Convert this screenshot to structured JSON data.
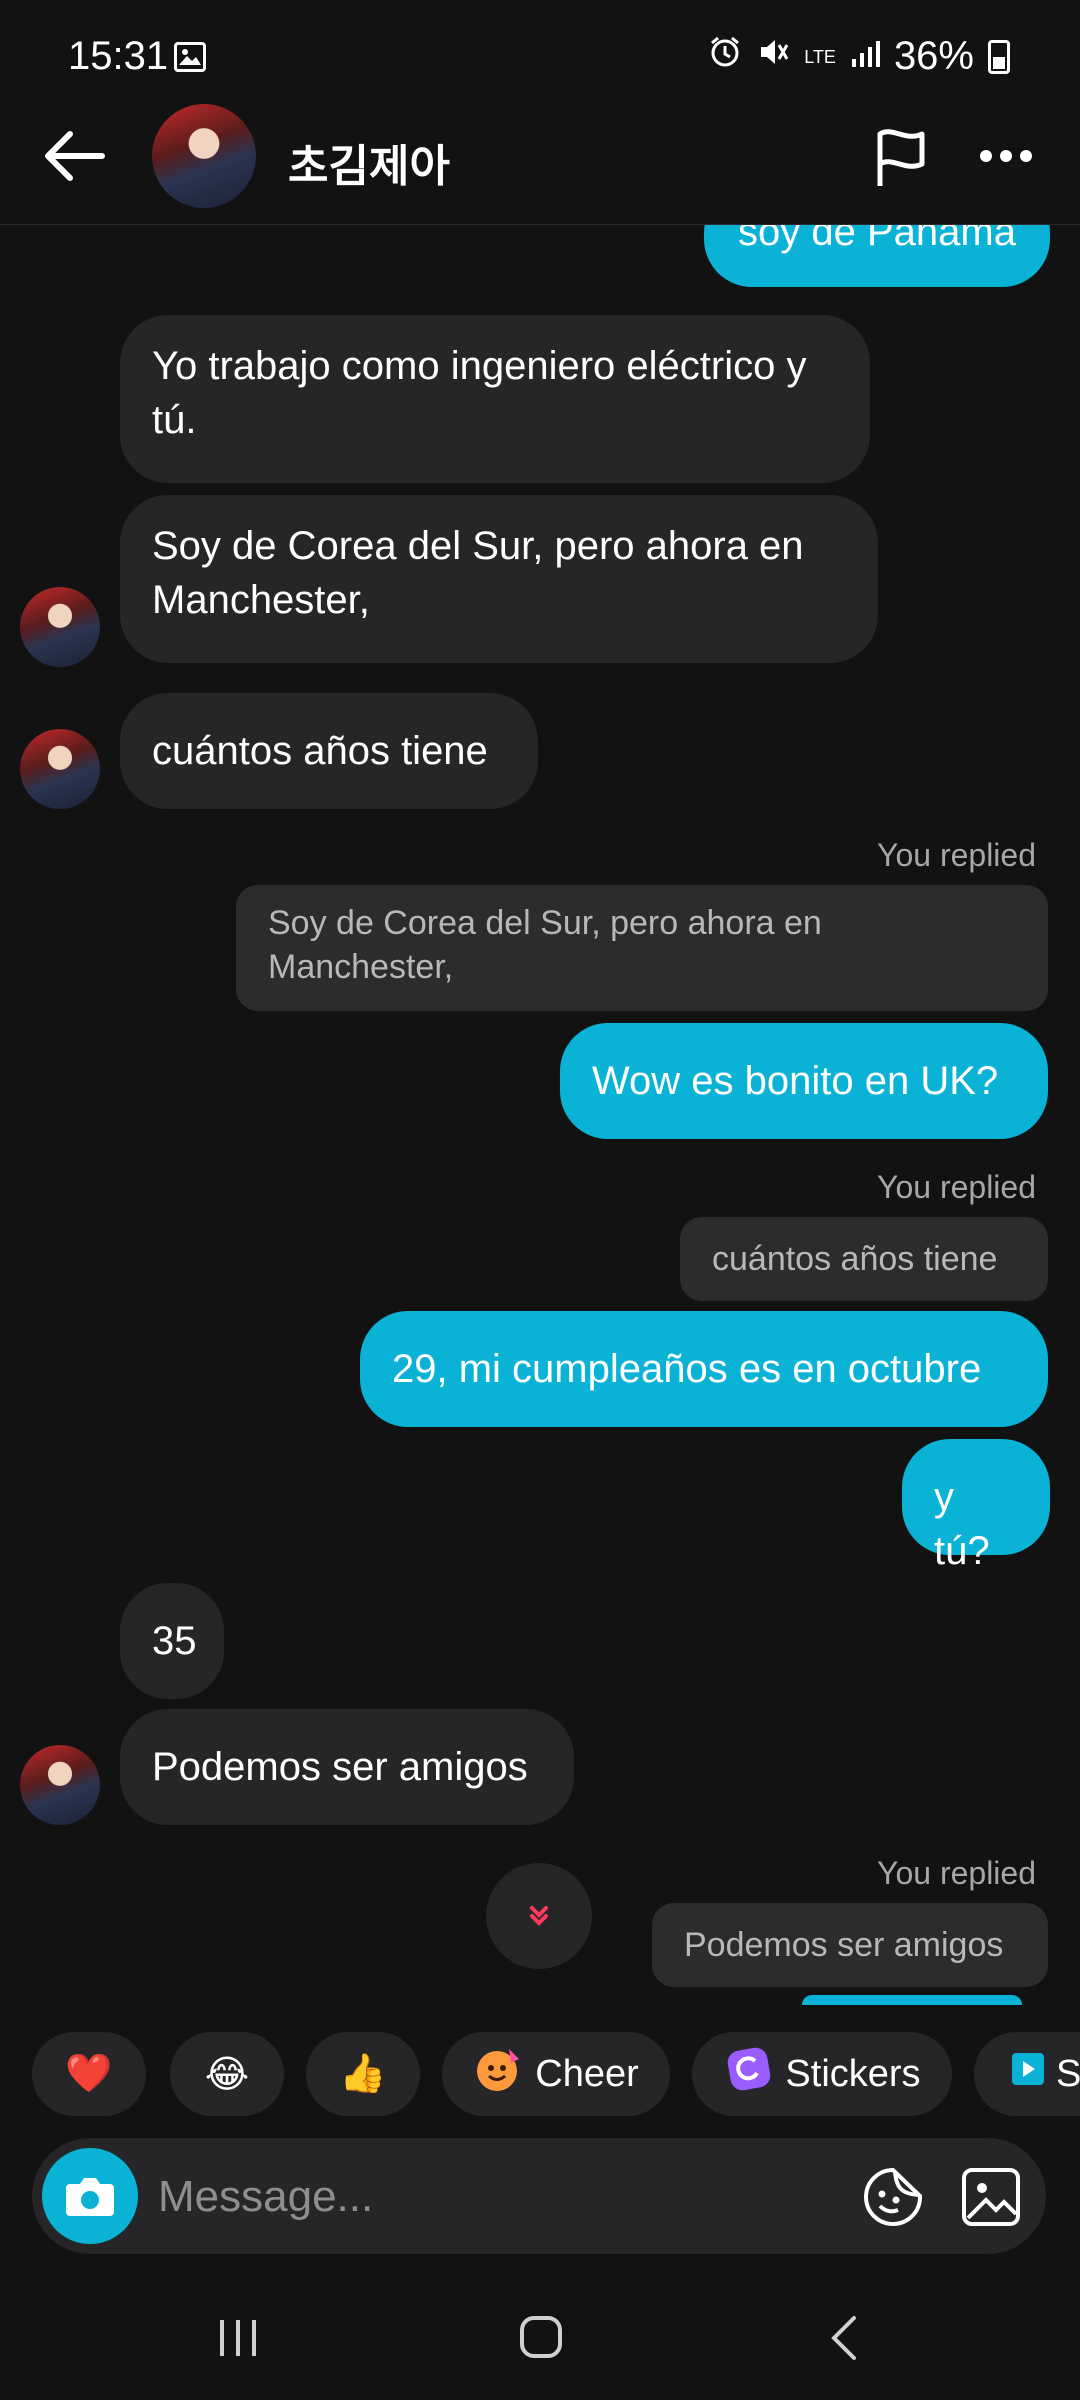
{
  "status": {
    "time": "15:31",
    "network": "LTE",
    "battery": "36%"
  },
  "header": {
    "name": "초김제아"
  },
  "messages": {
    "top_partial": "soy de Panamá",
    "m1": "Yo trabajo como ingeniero eléctrico y tú.",
    "m2": "Soy de Corea del Sur, pero ahora en Manchester,",
    "m3": "cuántos años tiene",
    "replied_label": "You replied",
    "quote1": "Soy de Corea del Sur, pero ahora en Manchester,",
    "r1": "Wow es bonito en UK?",
    "quote2": "cuántos años tiene",
    "r2": "29, mi cumpleaños es en octubre",
    "r3": "y tú?",
    "m4": "35",
    "m5": "Podemos ser amigos",
    "quote3": "Podemos ser amigos"
  },
  "quick": {
    "heart": "❤️",
    "laugh": "😂",
    "thumb": "👍",
    "cheer": "Cheer",
    "stickers": "Stickers",
    "partial": "S"
  },
  "composer": {
    "placeholder": "Message..."
  },
  "colors": {
    "accent": "#0ab2d5",
    "bubble_in": "#262628",
    "background": "#121213"
  }
}
